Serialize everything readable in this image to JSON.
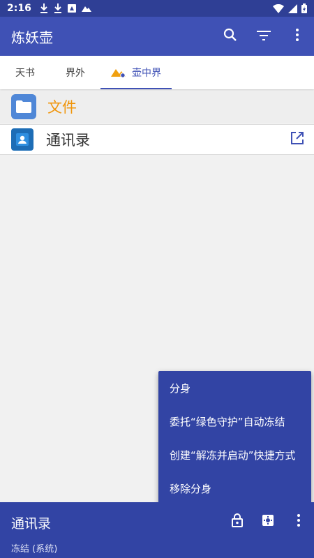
{
  "status_bar": {
    "time": "2:16",
    "left_icons": [
      "download-icon",
      "download-icon",
      "image-icon",
      "mountain-icon"
    ],
    "right_icons": [
      "wifi-icon",
      "signal-icon",
      "battery-icon"
    ]
  },
  "app_bar": {
    "title": "炼妖壶",
    "actions": [
      "search-icon",
      "filter-icon",
      "more-vert-icon"
    ]
  },
  "tabs": [
    {
      "label": "天书"
    },
    {
      "label": "界外"
    },
    {
      "label": "壶中界",
      "icon": "island-icon",
      "selected": true
    }
  ],
  "items": [
    {
      "label": "文件",
      "icon": "folder-icon"
    },
    {
      "label": "通讯录",
      "icon": "contacts-icon",
      "action_icon": "open-external-icon"
    }
  ],
  "popup_menu": {
    "items": [
      {
        "label": "分身"
      },
      {
        "label": "委托“绿色守护”自动冻结"
      },
      {
        "label": "创建“解冻并启动”快捷方式"
      },
      {
        "label": "移除分身"
      }
    ]
  },
  "bottom_bar": {
    "title": "通讯录",
    "subtitle": "冻结 (系统)",
    "actions": [
      "lock-icon",
      "settings-icon",
      "more-vert-icon"
    ]
  },
  "colors": {
    "status_bar": "#2f3f95",
    "primary": "#3f51b5",
    "bottom_bar": "#3244a4",
    "accent_orange": "#f0950a",
    "background": "#f1f1f1"
  }
}
